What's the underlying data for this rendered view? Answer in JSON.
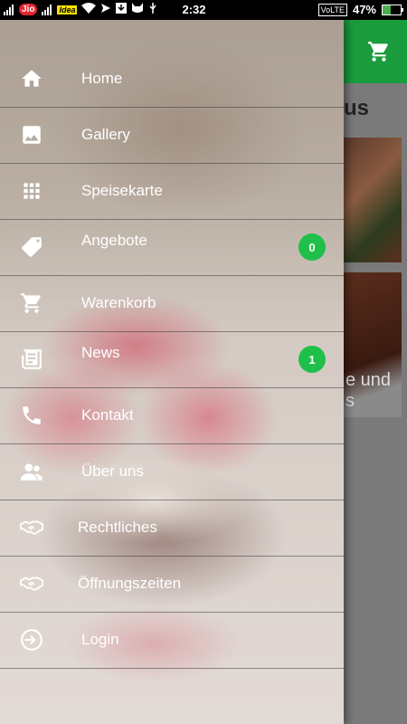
{
  "status_bar": {
    "carrier1": "Jio",
    "carrier2": "Idea",
    "time": "2:32",
    "volte": "VoLTE",
    "battery": "47%"
  },
  "app": {
    "title_fragment": "us",
    "card_text_fragment": "e und\ns",
    "header_color": "#1a9b3c"
  },
  "drawer": {
    "items": [
      {
        "label": "Home",
        "icon": "home-icon"
      },
      {
        "label": "Gallery",
        "icon": "image-icon"
      },
      {
        "label": "Speisekarte",
        "icon": "grid-icon"
      },
      {
        "label": "Angebote",
        "icon": "tag-icon",
        "badge": "0"
      },
      {
        "label": "Warenkorb",
        "icon": "cart-icon"
      },
      {
        "label": "News",
        "icon": "newspaper-icon",
        "badge": "1"
      },
      {
        "label": "Kontakt",
        "icon": "phone-icon"
      },
      {
        "label": "Über uns",
        "icon": "people-icon"
      },
      {
        "label": "Rechtliches",
        "icon": "handshake-icon"
      },
      {
        "label": "Öffnungszeiten",
        "icon": "handshake-icon"
      },
      {
        "label": "Login",
        "icon": "login-icon"
      }
    ],
    "badge_color": "#1fc04a"
  }
}
